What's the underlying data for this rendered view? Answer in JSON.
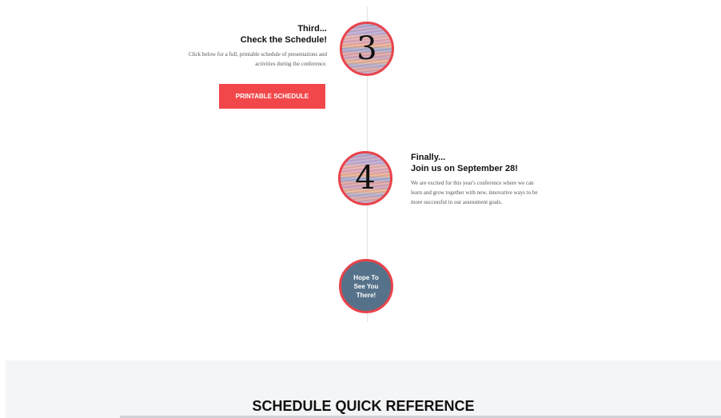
{
  "steps": [
    {
      "number": "3",
      "title": "Third...",
      "heading": "Check the Schedule!",
      "body": "Click below for a full, printable schedule of presentations and activities during the conference.",
      "button_label": "PRINTABLE SCHEDULE"
    },
    {
      "number": "4",
      "title": "Finally...",
      "heading": "Join us on September 28!",
      "body": "We are excited for this year's conference where we can learn and grow together with new, innovative ways to be more successful in our assessment goals."
    }
  ],
  "end_circle": {
    "text": "Hope To See You There!"
  },
  "quick_reference": {
    "title": "SCHEDULE QUICK REFERENCE"
  },
  "colors": {
    "accent": "#f2474a",
    "circle_border": "#e8434b",
    "end_circle_fill": "#56728a",
    "section_bg": "#f4f5f6"
  }
}
